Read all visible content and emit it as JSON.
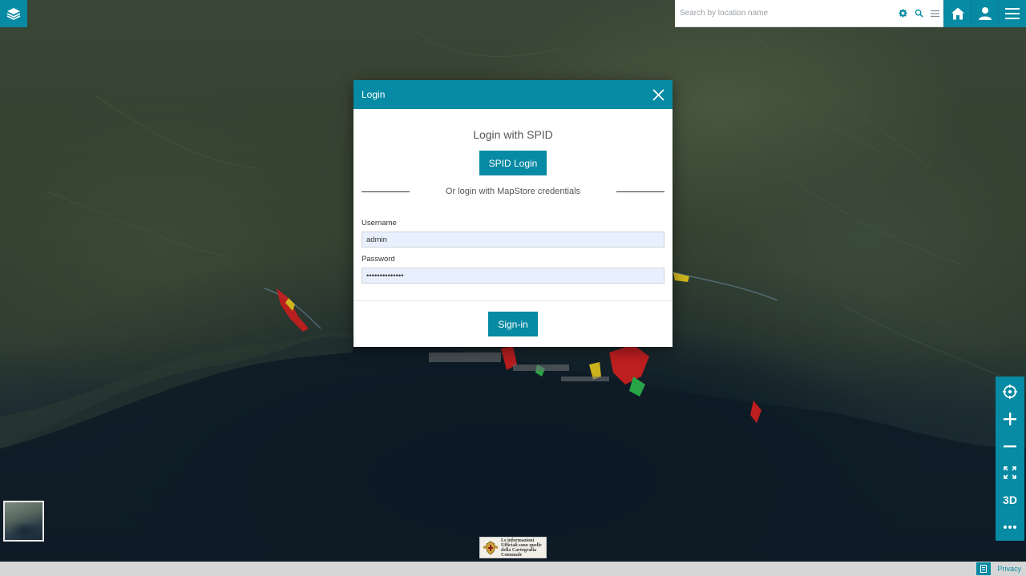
{
  "app": {
    "search": {
      "placeholder": "Search by location name"
    },
    "top_buttons": [
      {
        "name": "home-button",
        "icon": "home-icon"
      },
      {
        "name": "user-button",
        "icon": "user-icon"
      },
      {
        "name": "menu-button",
        "icon": "hamburger-icon"
      }
    ],
    "search_icons": [
      "gear-icon",
      "search-icon",
      "list-icon"
    ],
    "map_controls": {
      "three_d_label": "3D",
      "icons": [
        "locate-icon",
        "zoom-in-icon",
        "zoom-out-icon",
        "fullscreen-icon",
        "3d-toggle",
        "more-icon"
      ]
    },
    "attribution": {
      "text": "Le informazioni Ufficiali sono quelle della Cartografia Comunale"
    },
    "footer": {
      "privacy_label": "Privacy"
    },
    "colors": {
      "accent": "#078aa3",
      "footer_bg": "#d6d6d6",
      "input_bg": "#e8f0fe"
    }
  },
  "login_modal": {
    "title": "Login",
    "spid_heading": "Login with SPID",
    "spid_button": "SPID Login",
    "divider_text": "Or login with MapStore credentials",
    "username_label": "Username",
    "username_value": "admin",
    "password_label": "Password",
    "password_value": "••••••••••••••",
    "signin_button": "Sign-in"
  }
}
